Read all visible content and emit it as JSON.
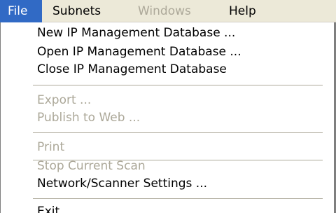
{
  "menubar": {
    "items": [
      {
        "label": "File",
        "state": "active"
      },
      {
        "label": "Subnets",
        "state": "enabled"
      },
      {
        "label": "Windows",
        "state": "disabled"
      },
      {
        "label": "Help",
        "state": "enabled"
      }
    ]
  },
  "file_menu": {
    "items": [
      {
        "label": "New IP Management Database ...",
        "enabled": true
      },
      {
        "label": "Open IP Management Database ...",
        "enabled": true
      },
      {
        "label": "Close IP Management Database",
        "enabled": true
      },
      {
        "label": "Export ...",
        "enabled": false
      },
      {
        "label": "Publish to Web ...",
        "enabled": false
      },
      {
        "label": "Print",
        "enabled": false
      },
      {
        "label": "Stop Current Scan",
        "enabled": false
      },
      {
        "label": "Network/Scanner Settings ...",
        "enabled": true
      },
      {
        "label": "Exit",
        "enabled": true
      }
    ]
  },
  "colors": {
    "menubar_background": "#ece9d8",
    "highlight": "#316ac5",
    "highlight_text": "#ffffff",
    "disabled_text": "#aca899",
    "menu_background": "#ffffff"
  }
}
